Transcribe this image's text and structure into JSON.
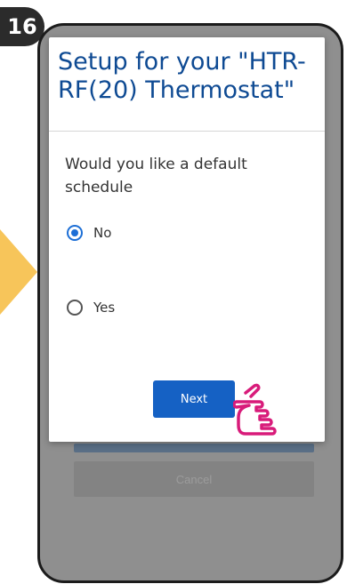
{
  "step": {
    "number": "16"
  },
  "dialog": {
    "title": "Setup for your \"HTR-RF(20) Thermostat\"",
    "question": "Would you like a default schedule",
    "options": [
      {
        "label": "No",
        "selected": true
      },
      {
        "label": "Yes",
        "selected": false
      }
    ],
    "next_label": "Next"
  },
  "background": {
    "cancel_label": "Cancel"
  },
  "colors": {
    "title": "#0e4a93",
    "button": "#1561c4",
    "radio_selected": "#1d6fd6",
    "arrow": "#f7c55a",
    "hand": "#d81b7a"
  },
  "icons": {
    "pointer": "hand-pointer-icon"
  }
}
